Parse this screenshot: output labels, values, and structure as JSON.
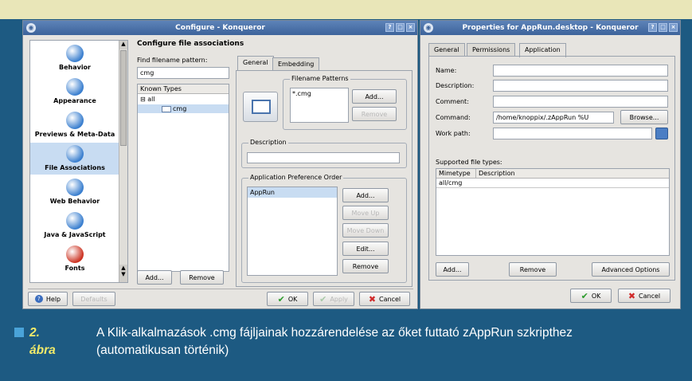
{
  "left_window": {
    "title": "Configure - Konqueror",
    "header": "Configure file associations",
    "sidebar": [
      {
        "label": "Behavior",
        "icon": "behavior-icon",
        "color": "#3a7fcf"
      },
      {
        "label": "Appearance",
        "icon": "appearance-icon",
        "color": "#3a7fcf"
      },
      {
        "label": "Previews & Meta-Data",
        "icon": "previews-icon",
        "color": "#3a7fcf"
      },
      {
        "label": "File Associations",
        "icon": "file-associations-icon",
        "color": "#3a7fcf",
        "selected": true
      },
      {
        "label": "Web Behavior",
        "icon": "web-behavior-icon",
        "color": "#3a7fcf"
      },
      {
        "label": "Java & JavaScript",
        "icon": "java-icon",
        "color": "#3a7fcf"
      },
      {
        "label": "Fonts",
        "icon": "fonts-icon",
        "color": "#cc3322"
      }
    ],
    "find_label": "Find filename pattern:",
    "find_value": "cmg",
    "known_types_header": "Known Types",
    "tree_root": "all",
    "tree_child": "cmg",
    "add_button": "Add...",
    "remove_button": "Remove",
    "tabs": [
      "General",
      "Embedding"
    ],
    "filename_patterns_title": "Filename Patterns",
    "pattern_value": "*.cmg",
    "pattern_add": "Add...",
    "pattern_remove": "Remove",
    "description_title": "Description",
    "app_pref_title": "Application Preference Order",
    "app_list": [
      "AppRun"
    ],
    "app_add": "Add...",
    "app_move_up": "Move Up",
    "app_move_down": "Move Down",
    "app_edit": "Edit...",
    "app_remove": "Remove",
    "help": "Help",
    "defaults": "Defaults",
    "ok": "OK",
    "apply": "Apply",
    "cancel": "Cancel"
  },
  "right_window": {
    "title": "Properties for AppRun.desktop - Konqueror",
    "tabs": [
      "General",
      "Permissions",
      "Application"
    ],
    "name_label": "Name:",
    "description_label": "Description:",
    "comment_label": "Comment:",
    "command_label": "Command:",
    "command_value": "/home/knoppix/.zAppRun %U",
    "browse": "Browse...",
    "workpath_label": "Work path:",
    "supported_label": "Supported file types:",
    "col_mimetype": "Mimetype",
    "col_description": "Description",
    "rows": [
      "all/cmg"
    ],
    "add": "Add...",
    "remove": "Remove",
    "advanced": "Advanced Options",
    "ok": "OK",
    "cancel": "Cancel"
  },
  "caption": {
    "number": "2. ábra",
    "text": "A Klik-alkalmazások .cmg fájljainak hozzárendelése az őket futtató zAppRun szkripthez (automatikusan történik)"
  }
}
